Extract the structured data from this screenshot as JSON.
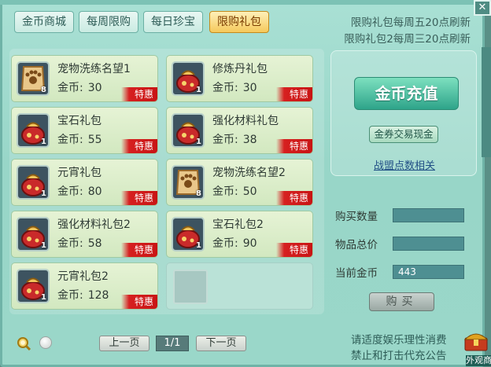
{
  "tabs": [
    {
      "label": "金币商城",
      "active": false
    },
    {
      "label": "每周限购",
      "active": false
    },
    {
      "label": "每日珍宝",
      "active": false
    },
    {
      "label": "限购礼包",
      "active": true
    }
  ],
  "refresh_notes": [
    "限购礼包每周五20点刷新",
    "限购礼包2每周三20点刷新"
  ],
  "price_prefix": "金币:",
  "deal_label": "特惠",
  "items": [
    {
      "name": "宠物洗练名望1",
      "price": "30",
      "qty": "8",
      "icon": "paw-scroll-icon"
    },
    {
      "name": "修炼丹礼包",
      "price": "30",
      "qty": "1",
      "icon": "gift-bag-icon"
    },
    {
      "name": "宝石礼包",
      "price": "55",
      "qty": "1",
      "icon": "gift-bag-icon"
    },
    {
      "name": "强化材料礼包",
      "price": "38",
      "qty": "1",
      "icon": "gift-bag-icon"
    },
    {
      "name": "元宵礼包",
      "price": "80",
      "qty": "1",
      "icon": "gift-bag-icon"
    },
    {
      "name": "宠物洗练名望2",
      "price": "50",
      "qty": "8",
      "icon": "paw-scroll-icon"
    },
    {
      "name": "强化材料礼包2",
      "price": "58",
      "qty": "1",
      "icon": "gift-bag-icon"
    },
    {
      "name": "宝石礼包2",
      "price": "90",
      "qty": "1",
      "icon": "gift-bag-icon"
    },
    {
      "name": "元宵礼包2",
      "price": "128",
      "qty": "1",
      "icon": "gift-bag-icon"
    }
  ],
  "recharge": {
    "main_button": "金币充值",
    "exchange_button": "金券交易现金",
    "alliance_link": "战盟点数相关"
  },
  "form": {
    "quantity_label": "购买数量",
    "quantity_value": "",
    "total_label": "物品总价",
    "total_value": "",
    "current_label": "当前金币",
    "current_value": "443",
    "buy_button": "购买"
  },
  "notices": [
    "请适度娱乐理性消费",
    "禁止和打击代充公告"
  ],
  "pager": {
    "prev": "上一页",
    "indicator": "1/1",
    "next": "下一页"
  },
  "side": {
    "welcome": "外观商"
  },
  "close_glyph": "✕"
}
